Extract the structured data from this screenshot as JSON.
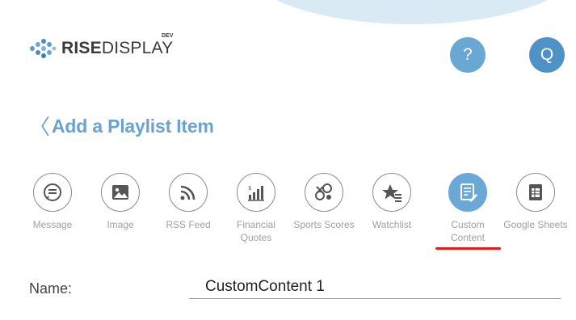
{
  "header": {
    "logo": {
      "brand_bold": "RISE",
      "brand_light": "DISPLAY",
      "env_badge": "DEV"
    },
    "help_button": {
      "label": "?",
      "icon": "help-icon"
    },
    "user_button": {
      "label": "Q",
      "icon": "user-avatar"
    }
  },
  "page": {
    "back_chevron": "〈",
    "title": "Add a Playlist Item"
  },
  "item_types": [
    {
      "key": "message",
      "label": "Message",
      "icon": "message-icon",
      "selected": false
    },
    {
      "key": "image",
      "label": "Image",
      "icon": "image-icon",
      "selected": false
    },
    {
      "key": "rss",
      "label": "RSS Feed",
      "icon": "rss-icon",
      "selected": false
    },
    {
      "key": "financial",
      "label": "Financial Quotes",
      "icon": "financial-quotes-icon",
      "selected": false
    },
    {
      "key": "sports",
      "label": "Sports Scores",
      "icon": "sports-scores-icon",
      "selected": false
    },
    {
      "key": "watchlist",
      "label": "Watchlist",
      "icon": "watchlist-icon",
      "selected": false
    },
    {
      "key": "custom",
      "label": "Custom Content",
      "icon": "custom-content-icon",
      "selected": true
    },
    {
      "key": "sheets",
      "label": "Google Sheets",
      "icon": "google-sheets-icon",
      "selected": false
    }
  ],
  "form": {
    "name_label": "Name:",
    "name_value": "CustomContent 1"
  },
  "colors": {
    "accent": "#6aa8d8",
    "title_blue": "#6aa3cf",
    "highlight_red": "#e0201f"
  }
}
